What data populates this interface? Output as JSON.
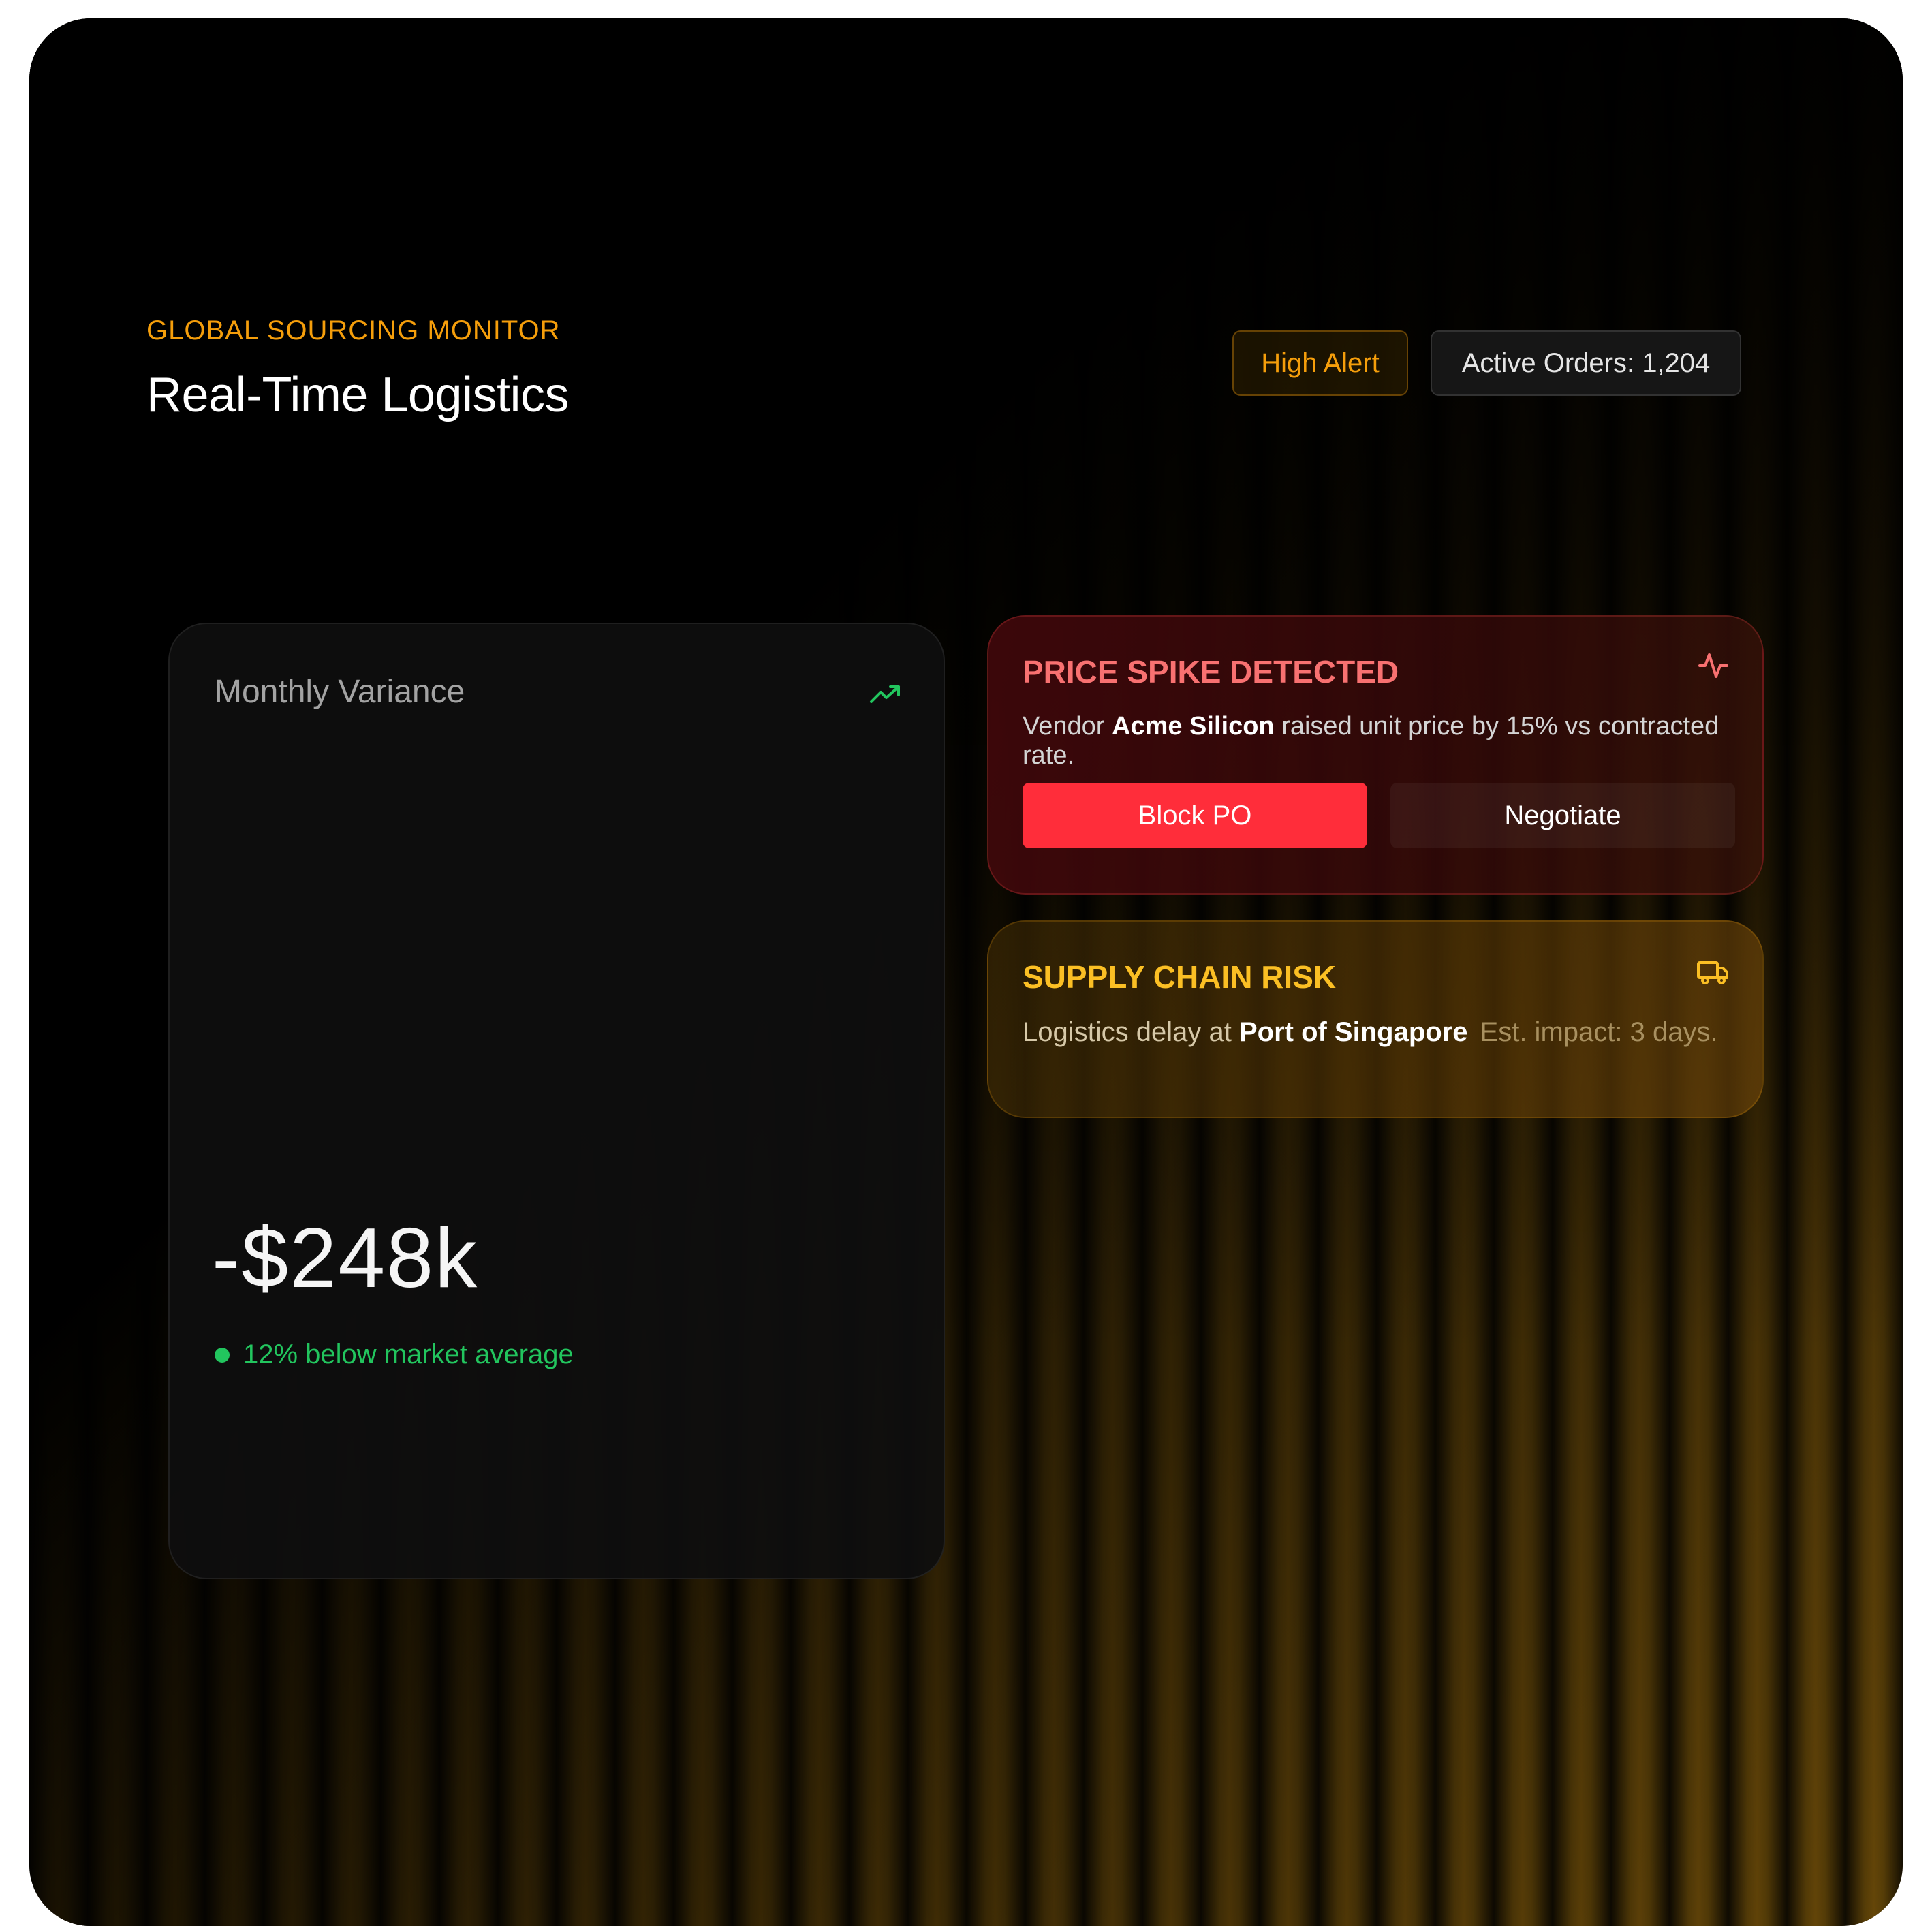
{
  "header": {
    "eyebrow": "GLOBAL SOURCING MONITOR",
    "title": "Real-Time Logistics",
    "badges": {
      "alert": "High Alert",
      "orders": "Active Orders: 1,204"
    }
  },
  "variance_card": {
    "title": "Monthly Variance",
    "icon": "trending-up-icon",
    "value": "-$248k",
    "note": "12% below market average",
    "note_color": "#22c55e"
  },
  "price_alert": {
    "title": "PRICE SPIKE DETECTED",
    "icon": "pulse-icon",
    "desc_prefix": "Vendor ",
    "vendor": "Acme Silicon",
    "desc_suffix": " raised unit price by 15% vs contracted rate.",
    "buttons": {
      "block": "Block PO",
      "negotiate": "Negotiate"
    },
    "accent": "#f87171",
    "button_color": "#ff2d3a"
  },
  "supply_alert": {
    "title": "SUPPLY CHAIN RISK",
    "icon": "truck-icon",
    "desc_prefix": "Logistics delay at ",
    "location": "Port of Singapore",
    "impact": "Est. impact: 3 days.",
    "accent": "#fbbf24"
  },
  "colors": {
    "brand_orange": "#f59e0b",
    "background": "#000000"
  }
}
